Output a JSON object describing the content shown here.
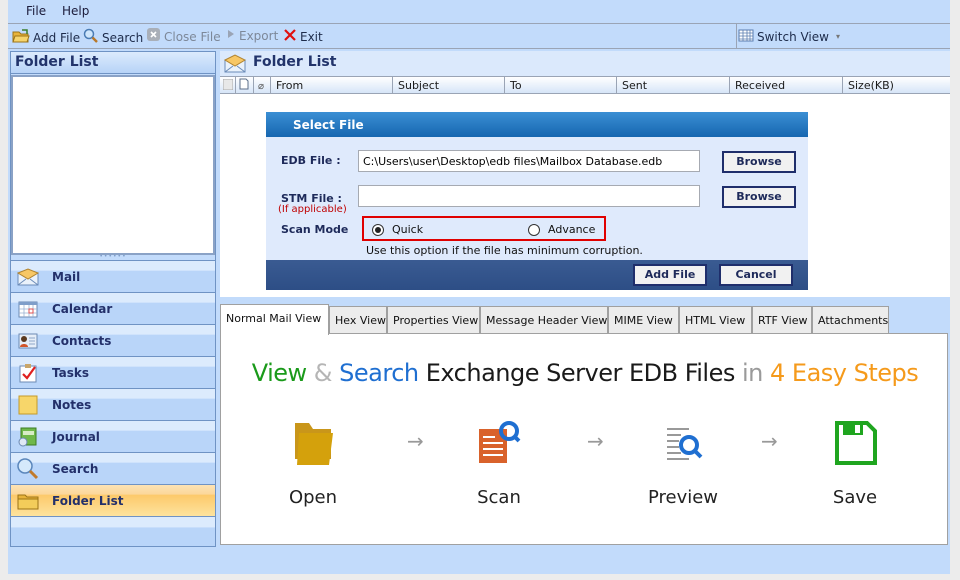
{
  "menu": {
    "file": "File",
    "help": "Help"
  },
  "toolbar": {
    "add_file": "Add File",
    "search": "Search",
    "close_file": "Close File",
    "export": "Export",
    "exit": "Exit",
    "switch_view": "Switch View"
  },
  "left_panel": {
    "title": "Folder List",
    "nav": [
      {
        "label": "Mail",
        "icon": "mail-icon"
      },
      {
        "label": "Calendar",
        "icon": "calendar-icon"
      },
      {
        "label": "Contacts",
        "icon": "contacts-icon"
      },
      {
        "label": "Tasks",
        "icon": "tasks-icon"
      },
      {
        "label": "Notes",
        "icon": "notes-icon"
      },
      {
        "label": "Journal",
        "icon": "journal-icon"
      },
      {
        "label": "Search",
        "icon": "search-icon"
      },
      {
        "label": "Folder List",
        "icon": "folder-icon",
        "active": true
      }
    ]
  },
  "main": {
    "title": "Folder List",
    "columns": [
      "From",
      "Subject",
      "To",
      "Sent",
      "Received",
      "Size(KB)"
    ]
  },
  "dialog": {
    "title": "Select File",
    "edb_label": "EDB File :",
    "edb_value": "C:\\Users\\user\\Desktop\\edb files\\Mailbox Database.edb",
    "stm_label": "STM File :",
    "stm_sub": "(If applicable)",
    "stm_value": "",
    "browse": "Browse",
    "scan_label": "Scan Mode",
    "quick": "Quick",
    "advance": "Advance",
    "selected_mode": "Quick",
    "hint": "Use this option if the file has minimum corruption.",
    "add_file": "Add File",
    "cancel": "Cancel"
  },
  "tabs": [
    "Normal Mail View",
    "Hex View",
    "Properties View",
    "Message Header View",
    "MIME View",
    "HTML View",
    "RTF View",
    "Attachments"
  ],
  "active_tab": "Normal Mail View",
  "banner": {
    "parts": [
      {
        "text": "View",
        "color": "#1a9a1a"
      },
      {
        "text": " & ",
        "color": "#b5b5b5"
      },
      {
        "text": "Search",
        "color": "#1f6fd1"
      },
      {
        "text": " Exchange Server EDB Files ",
        "color": "#1a1a1a"
      },
      {
        "text": "in ",
        "color": "#9a9a9a"
      },
      {
        "text": "4 Easy Steps",
        "color": "#f59a1b"
      }
    ],
    "steps": [
      "Open",
      "Scan",
      "Preview",
      "Save"
    ]
  }
}
